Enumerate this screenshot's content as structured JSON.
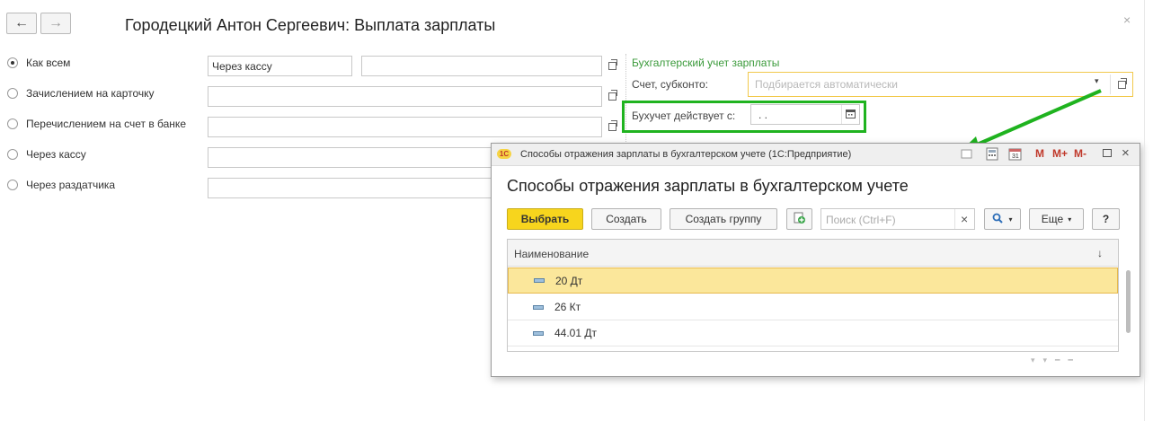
{
  "header": {
    "back_icon": "←",
    "forward_icon": "→",
    "title": "Городецкий Антон Сергеевич: Выплата зарплаты",
    "close_icon": "×"
  },
  "payment_options": [
    {
      "label": "Как всем",
      "selected": true
    },
    {
      "label": "Зачислением на карточку",
      "selected": false
    },
    {
      "label": "Перечислением на счет в банке",
      "selected": false
    },
    {
      "label": "Через кассу",
      "selected": false
    },
    {
      "label": "Через раздатчика",
      "selected": false
    }
  ],
  "fields": {
    "row1_value": "Через кассу"
  },
  "accounting": {
    "section_title": "Бухгалтерский учет зарплаты",
    "account_label": "Счет, субконто:",
    "account_placeholder": "Подбирается автоматически",
    "effective_label": "Бухучет действует с:",
    "effective_value": " .  ."
  },
  "modal": {
    "window_title": "Способы отражения зарплаты в бухгалтерском учете  (1С:Предприятие)",
    "heading": "Способы отражения зарплаты в бухгалтерском учете",
    "titlebar_icons": [
      "М",
      "М+",
      "М-"
    ],
    "toolbar": {
      "select_label": "Выбрать",
      "create_label": "Создать",
      "create_group_label": "Создать группу",
      "search_placeholder": "Поиск (Ctrl+F)",
      "clear_icon": "×",
      "more_label": "Еще",
      "help_label": "?"
    },
    "table": {
      "column_name": "Наименование",
      "sort_icon": "↓",
      "rows": [
        "20 Дт",
        "26 Кт",
        "44.01 Дт"
      ],
      "selected_index": 0
    }
  },
  "colors": {
    "accent_yellow": "#f7d51d",
    "selected_row": "#fbe79b",
    "highlight_green": "#1fb31f",
    "section_green": "#3a9a3a"
  }
}
